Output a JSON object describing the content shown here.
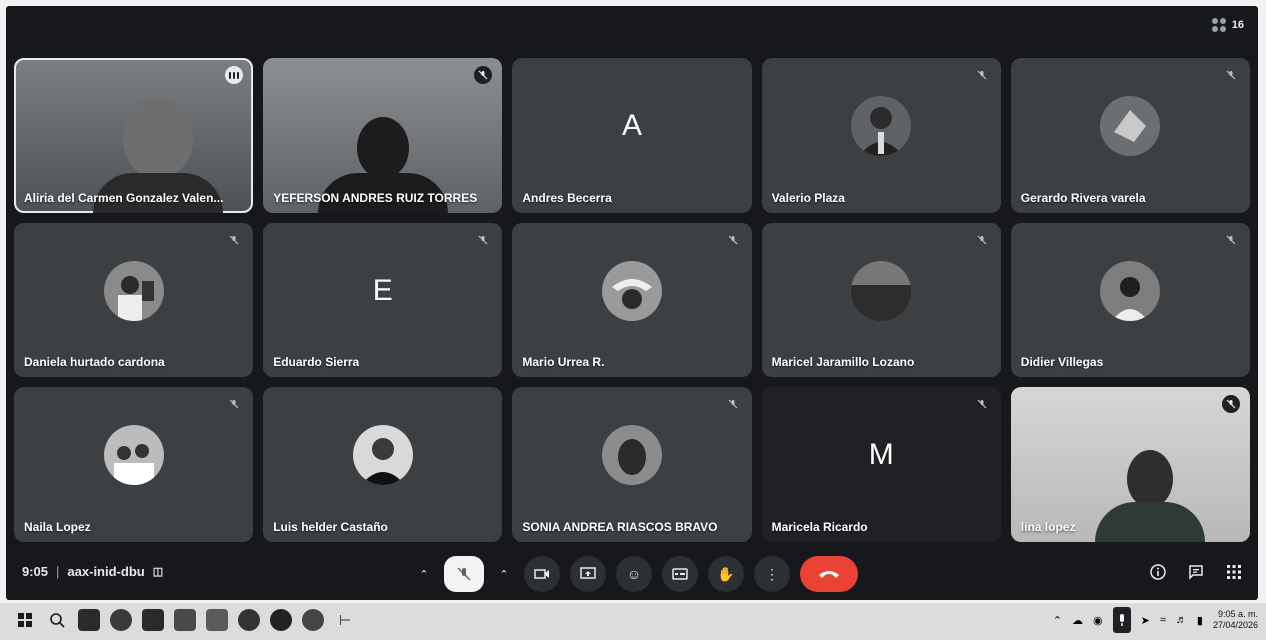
{
  "participant_count": "16",
  "participants": [
    {
      "name": "Aliria del Carmen Gonzalez Valen...",
      "mode": "video",
      "speaking": true
    },
    {
      "name": "YEFERSON ANDRES RUIZ TORRES",
      "mode": "video"
    },
    {
      "name": "Andres Becerra",
      "mode": "letter",
      "letter": "A"
    },
    {
      "name": "Valerio Plaza",
      "mode": "avatar"
    },
    {
      "name": "Gerardo Rivera varela",
      "mode": "avatar"
    },
    {
      "name": "Daniela hurtado cardona",
      "mode": "avatar"
    },
    {
      "name": "Eduardo Sierra",
      "mode": "letter",
      "letter": "E"
    },
    {
      "name": "Mario Urrea R.",
      "mode": "avatar"
    },
    {
      "name": "Maricel Jaramillo Lozano",
      "mode": "avatar"
    },
    {
      "name": "Didier Villegas",
      "mode": "avatar"
    },
    {
      "name": "Naila Lopez",
      "mode": "avatar"
    },
    {
      "name": "Luis helder Castaño",
      "mode": "avatar"
    },
    {
      "name": "SONIA ANDREA RIASCOS BRAVO",
      "mode": "avatar"
    },
    {
      "name": "Maricela Ricardo",
      "mode": "letter",
      "letter": "M"
    },
    {
      "name": "lina lopez",
      "mode": "video"
    }
  ],
  "meeting": {
    "time": "9:05",
    "separator": "|",
    "code": "aax-inid-dbu"
  },
  "taskbar": {
    "time": "9:05 a. m.",
    "date": "27/04/2026"
  },
  "colors": {
    "accent": "#e8eaed",
    "end_call": "#ea4335",
    "tile": "#3c4043",
    "background": "#16181b"
  }
}
